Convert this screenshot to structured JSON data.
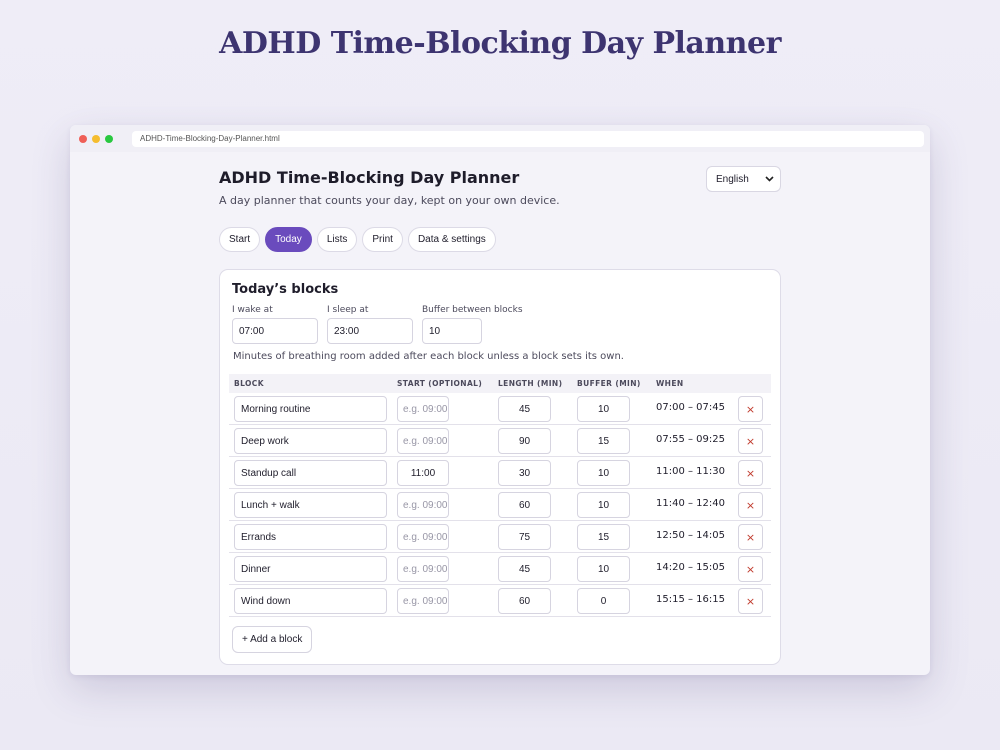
{
  "hero_title": "ADHD Time-Blocking Day Planner",
  "browser": {
    "url": "ADHD-Time-Blocking-Day-Planner.html"
  },
  "app": {
    "title": "ADHD Time-Blocking Day Planner",
    "subtitle": "A day planner that counts your day, kept on your own device.",
    "language": "English"
  },
  "tabs": [
    {
      "label": "Start",
      "active": false
    },
    {
      "label": "Today",
      "active": true
    },
    {
      "label": "Lists",
      "active": false
    },
    {
      "label": "Print",
      "active": false
    },
    {
      "label": "Data & settings",
      "active": false
    }
  ],
  "card": {
    "title": "Today’s blocks",
    "wake_label": "I wake at",
    "wake_value": "07:00",
    "sleep_label": "I sleep at",
    "sleep_value": "23:00",
    "buffer_label": "Buffer between blocks",
    "buffer_value": "10",
    "hint": "Minutes of breathing room added after each block unless a block sets its own.",
    "columns": [
      "BLOCK",
      "START (OPTIONAL)",
      "LENGTH (MIN)",
      "BUFFER (MIN)",
      "WHEN"
    ],
    "start_placeholder": "e.g. 09:00",
    "delete_glyph": "×",
    "add_label": "+ Add a block",
    "rows": [
      {
        "name": "Morning routine",
        "start": "",
        "length": "45",
        "buffer": "10",
        "when": "07:00 – 07:45"
      },
      {
        "name": "Deep work",
        "start": "",
        "length": "90",
        "buffer": "15",
        "when": "07:55 – 09:25"
      },
      {
        "name": "Standup call",
        "start": "11:00",
        "length": "30",
        "buffer": "10",
        "when": "11:00 – 11:30"
      },
      {
        "name": "Lunch + walk",
        "start": "",
        "length": "60",
        "buffer": "10",
        "when": "11:40 – 12:40"
      },
      {
        "name": "Errands",
        "start": "",
        "length": "75",
        "buffer": "15",
        "when": "12:50 – 14:05"
      },
      {
        "name": "Dinner",
        "start": "",
        "length": "45",
        "buffer": "10",
        "when": "14:20 – 15:05"
      },
      {
        "name": "Wind down",
        "start": "",
        "length": "60",
        "buffer": "0",
        "when": "15:15 – 16:15"
      }
    ]
  },
  "colors": {
    "accent": "#6a4bbd",
    "hero": "#3d3470",
    "delete": "#c0392b"
  }
}
